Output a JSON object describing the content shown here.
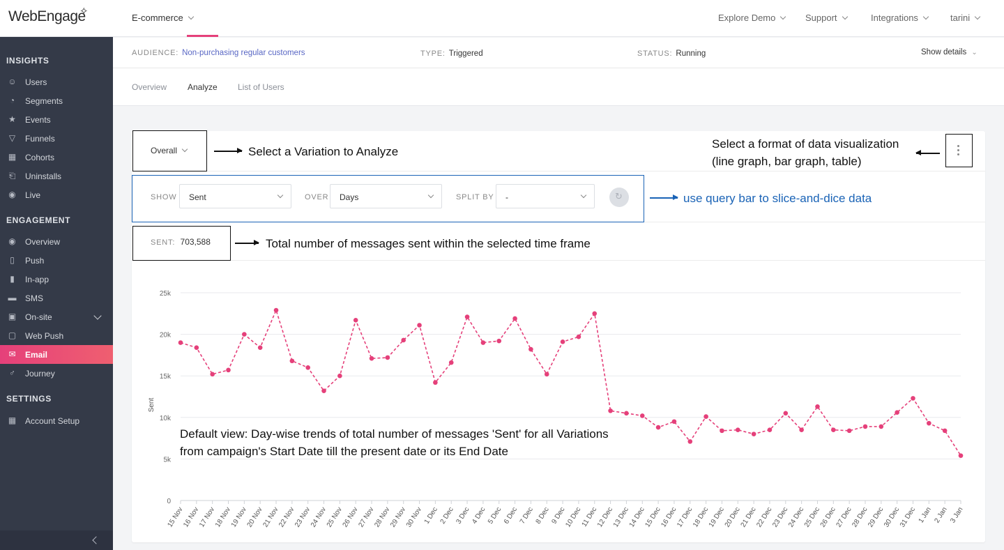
{
  "app": {
    "logo": "WebEngage",
    "project": "E-commerce",
    "nav": [
      {
        "label": "Explore Demo",
        "x": 1030
      },
      {
        "label": "Support",
        "x": 1155
      },
      {
        "label": "Integrations",
        "x": 1249
      },
      {
        "label": "tarini",
        "x": 1363
      }
    ]
  },
  "sidebar": {
    "sections": {
      "insights": "INSIGHTS",
      "engagement": "ENGAGEMENT",
      "settings": "SETTINGS"
    },
    "insights": [
      "Users",
      "Segments",
      "Events",
      "Funnels",
      "Cohorts",
      "Uninstalls",
      "Live"
    ],
    "engagement": [
      "Overview",
      "Push",
      "In-app",
      "SMS",
      "On-site",
      "Web Push",
      "Email",
      "Journey"
    ],
    "settings": [
      "Account Setup"
    ],
    "active": "Email"
  },
  "campaign": {
    "audience_label": "AUDIENCE:",
    "audience": "Non-purchasing regular customers",
    "type_label": "TYPE:",
    "type": "Triggered",
    "status_label": "STATUS:",
    "status": "Running",
    "show_details": "Show details"
  },
  "tabs": {
    "overview": "Overview",
    "analyze": "Analyze",
    "list_of_users": "List of Users"
  },
  "analysis": {
    "variation": "Overall",
    "show_label": "SHOW",
    "show_value": "Sent",
    "over_label": "OVER",
    "over_value": "Days",
    "split_label": "SPLIT BY",
    "split_value": "-",
    "sent_label": "SENT:",
    "sent_value": "703,588"
  },
  "annotations": {
    "variation": "Select a Variation to Analyze",
    "format_line1": "Select a format of data visualization",
    "format_line2": "(line graph, bar graph, table)",
    "query": "use query bar to slice-and-dice data",
    "sent": "Total number of messages sent within the selected time frame",
    "default_line1": "Default view: Day-wise trends of total number of messages 'Sent' for all Variations",
    "default_line2": "from campaign's Start Date till the present date or its End Date"
  },
  "colors": {
    "accent": "#e5407a",
    "sidebar": "#343a48",
    "annotation_blue": "#1a63b6"
  },
  "chart_data": {
    "type": "line",
    "ylabel": "Sent",
    "ylim": [
      0,
      25000
    ],
    "yticks": [
      "0",
      "5k",
      "10k",
      "15k",
      "20k",
      "25k"
    ],
    "grid": true,
    "series": [
      {
        "values": [
          19000,
          18400,
          15200,
          15700,
          20000,
          18400,
          22900,
          16800,
          16000,
          13200,
          15000,
          21700,
          17100,
          17200,
          19300,
          21100,
          14200,
          16600,
          22100,
          19000,
          19200,
          21900,
          18200,
          15200,
          19100,
          19700,
          22500,
          10800,
          10500,
          10200,
          8800,
          9500,
          7100,
          10100,
          8400,
          8500,
          8000,
          8500,
          10500,
          8500,
          11300,
          8500,
          8400,
          8900,
          8900,
          10600,
          12300,
          9300,
          8400,
          5400
        ]
      }
    ],
    "categories": [
      "15 Nov",
      "16 Nov",
      "17 Nov",
      "18 Nov",
      "19 Nov",
      "20 Nov",
      "21 Nov",
      "22 Nov",
      "23 Nov",
      "24 Nov",
      "25 Nov",
      "26 Nov",
      "27 Nov",
      "28 Nov",
      "29 Nov",
      "30 Nov",
      "1 Dec",
      "2 Dec",
      "3 Dec",
      "4 Dec",
      "5 Dec",
      "6 Dec",
      "7 Dec",
      "8 Dec",
      "9 Dec",
      "10 Dec",
      "11 Dec",
      "12 Dec",
      "13 Dec",
      "14 Dec",
      "15 Dec",
      "16 Dec",
      "17 Dec",
      "18 Dec",
      "19 Dec",
      "20 Dec",
      "21 Dec",
      "22 Dec",
      "23 Dec",
      "24 Dec",
      "25 Dec",
      "26 Dec",
      "27 Dec",
      "28 Dec",
      "29 Dec",
      "30 Dec",
      "31 Dec",
      "1 Jan",
      "2 Jan",
      "3 Jan"
    ]
  }
}
